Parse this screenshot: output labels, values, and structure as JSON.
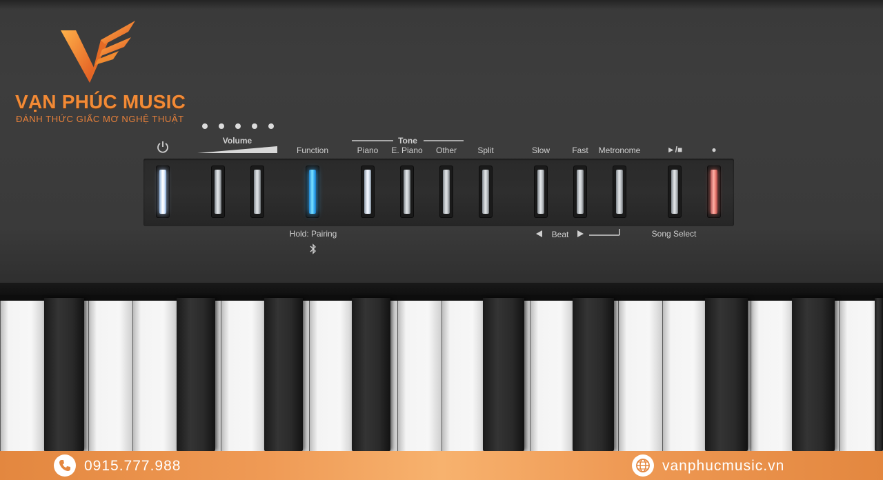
{
  "brand": {
    "name": "VẠN PHÚC MUSIC",
    "tagline": "ĐÁNH THỨC GIẤC MƠ NGHỆ THUẬT",
    "accent": "#f28a36"
  },
  "panel": {
    "volume_label": "Volume",
    "function_label": "Function",
    "tone_label": "Tone",
    "piano_label": "Piano",
    "epiano_label": "E. Piano",
    "other_label": "Other",
    "split_label": "Split",
    "slow_label": "Slow",
    "fast_label": "Fast",
    "metronome_label": "Metronome",
    "play_stop_label": "►/■",
    "record_label": "●",
    "hold_pairing_label": "Hold: Pairing",
    "beat_label": "Beat",
    "song_select_label": "Song Select",
    "power_icon": "power-icon",
    "bluetooth_icon": "bluetooth-icon"
  },
  "footer": {
    "phone": "0915.777.988",
    "website": "vanphucmusic.vn",
    "phone_icon": "phone-icon",
    "globe_icon": "globe-icon",
    "color": "#ef9a55"
  }
}
